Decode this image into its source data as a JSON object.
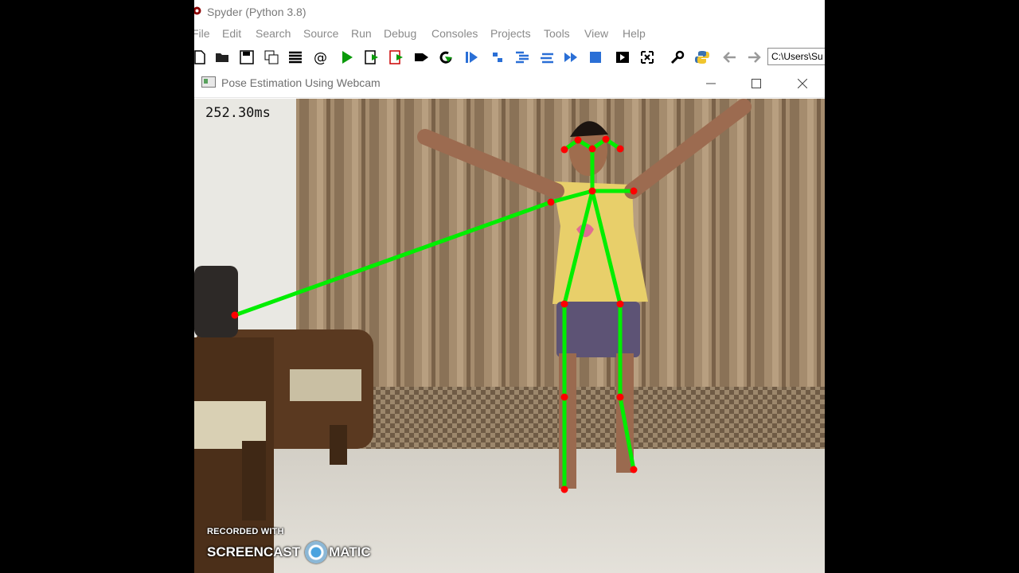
{
  "spyder": {
    "title": "Spyder (Python 3.8)",
    "menu": [
      "File",
      "Edit",
      "Search",
      "Source",
      "Run",
      "Debug",
      "Consoles",
      "Projects",
      "Tools",
      "View",
      "Help"
    ],
    "path_value": "C:\\Users\\Su",
    "toolbar_icons": [
      "new-file-icon",
      "open-folder-icon",
      "save-icon",
      "save-all-icon",
      "outline-icon",
      "at-icon",
      "run-icon",
      "run-cell-icon",
      "run-cell-advance-icon",
      "run-selection-icon",
      "rerun-icon",
      "debug-icon",
      "step-icon",
      "step-into-icon",
      "continue-icon",
      "stop-icon",
      "maximize-pane-icon",
      "fullscreen-icon",
      "wrench-icon",
      "python-icon",
      "back-arrow-icon",
      "forward-arrow-icon"
    ]
  },
  "window": {
    "title": "Pose Estimation Using Webcam",
    "controls": [
      "minimize",
      "maximize",
      "close"
    ]
  },
  "frame": {
    "inference_time": "252.30ms",
    "skeleton_color": "#00ee00",
    "keypoint_color": "#ff0000"
  },
  "watermark": {
    "line1": "RECORDED WITH",
    "brand_left": "SCREENCAST",
    "brand_right": "MATIC"
  }
}
